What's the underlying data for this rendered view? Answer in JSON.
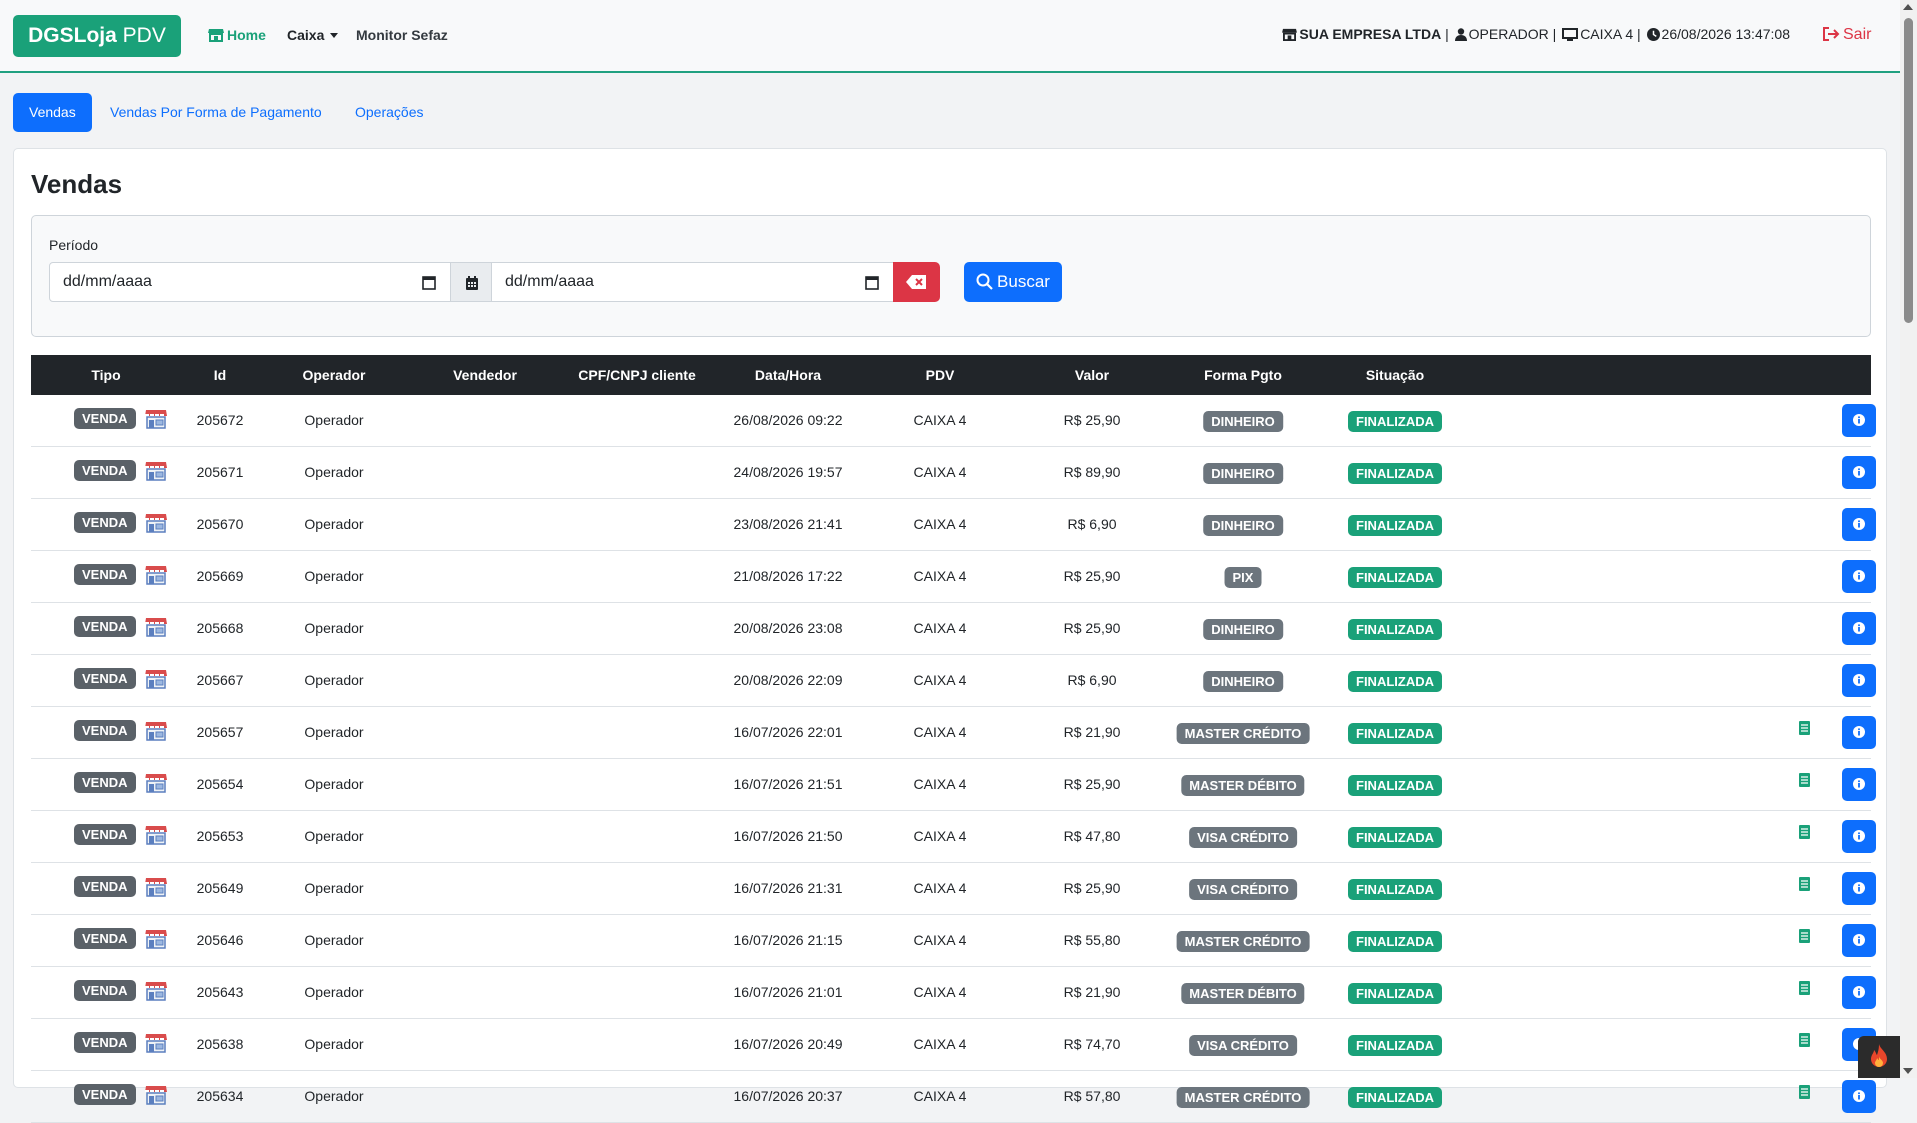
{
  "brand": {
    "name": "DGSLoja",
    "suffix": "PDV"
  },
  "nav": {
    "home": "Home",
    "caixa": "Caixa",
    "monitor": "Monitor Sefaz",
    "company": "SUA EMPRESA LTDA",
    "operator": "OPERADOR",
    "terminal": "CAIXA 4",
    "datetime": "26/08/2026 13:47:08",
    "separator": "|",
    "logout": "Sair"
  },
  "tabs": [
    {
      "label": "Vendas",
      "active": true
    },
    {
      "label": "Vendas Por Forma de Pagamento",
      "active": false
    },
    {
      "label": "Operações",
      "active": false
    }
  ],
  "page": {
    "title": "Vendas"
  },
  "filter": {
    "label": "Período",
    "date_from": "dd/mm/aaaa",
    "date_to": "dd/mm/aaaa",
    "search_label": "Buscar"
  },
  "table": {
    "headers": [
      "Tipo",
      "Id",
      "Operador",
      "Vendedor",
      "CPF/CNPJ cliente",
      "Data/Hora",
      "PDV",
      "Valor",
      "Forma Pgto",
      "Situação"
    ],
    "rows": [
      {
        "tipo": "VENDA",
        "id": "205672",
        "operador": "Operador",
        "vendedor": "",
        "cpf": "",
        "datahora": "26/08/2026 09:22",
        "pdv": "CAIXA 4",
        "valor": "R$ 25,90",
        "forma": "DINHEIRO",
        "situacao": "FINALIZADA",
        "nf": false
      },
      {
        "tipo": "VENDA",
        "id": "205671",
        "operador": "Operador",
        "vendedor": "",
        "cpf": "",
        "datahora": "24/08/2026 19:57",
        "pdv": "CAIXA 4",
        "valor": "R$ 89,90",
        "forma": "DINHEIRO",
        "situacao": "FINALIZADA",
        "nf": false
      },
      {
        "tipo": "VENDA",
        "id": "205670",
        "operador": "Operador",
        "vendedor": "",
        "cpf": "",
        "datahora": "23/08/2026 21:41",
        "pdv": "CAIXA 4",
        "valor": "R$ 6,90",
        "forma": "DINHEIRO",
        "situacao": "FINALIZADA",
        "nf": false
      },
      {
        "tipo": "VENDA",
        "id": "205669",
        "operador": "Operador",
        "vendedor": "",
        "cpf": "",
        "datahora": "21/08/2026 17:22",
        "pdv": "CAIXA 4",
        "valor": "R$ 25,90",
        "forma": "PIX",
        "situacao": "FINALIZADA",
        "nf": false
      },
      {
        "tipo": "VENDA",
        "id": "205668",
        "operador": "Operador",
        "vendedor": "",
        "cpf": "",
        "datahora": "20/08/2026 23:08",
        "pdv": "CAIXA 4",
        "valor": "R$ 25,90",
        "forma": "DINHEIRO",
        "situacao": "FINALIZADA",
        "nf": false
      },
      {
        "tipo": "VENDA",
        "id": "205667",
        "operador": "Operador",
        "vendedor": "",
        "cpf": "",
        "datahora": "20/08/2026 22:09",
        "pdv": "CAIXA 4",
        "valor": "R$ 6,90",
        "forma": "DINHEIRO",
        "situacao": "FINALIZADA",
        "nf": false
      },
      {
        "tipo": "VENDA",
        "id": "205657",
        "operador": "Operador",
        "vendedor": "",
        "cpf": "",
        "datahora": "16/07/2026 22:01",
        "pdv": "CAIXA 4",
        "valor": "R$ 21,90",
        "forma": "MASTER CRÉDITO",
        "situacao": "FINALIZADA",
        "nf": true
      },
      {
        "tipo": "VENDA",
        "id": "205654",
        "operador": "Operador",
        "vendedor": "",
        "cpf": "",
        "datahora": "16/07/2026 21:51",
        "pdv": "CAIXA 4",
        "valor": "R$ 25,90",
        "forma": "MASTER DÉBITO",
        "situacao": "FINALIZADA",
        "nf": true
      },
      {
        "tipo": "VENDA",
        "id": "205653",
        "operador": "Operador",
        "vendedor": "",
        "cpf": "",
        "datahora": "16/07/2026 21:50",
        "pdv": "CAIXA 4",
        "valor": "R$ 47,80",
        "forma": "VISA CRÉDITO",
        "situacao": "FINALIZADA",
        "nf": true
      },
      {
        "tipo": "VENDA",
        "id": "205649",
        "operador": "Operador",
        "vendedor": "",
        "cpf": "",
        "datahora": "16/07/2026 21:31",
        "pdv": "CAIXA 4",
        "valor": "R$ 25,90",
        "forma": "VISA CRÉDITO",
        "situacao": "FINALIZADA",
        "nf": true
      },
      {
        "tipo": "VENDA",
        "id": "205646",
        "operador": "Operador",
        "vendedor": "",
        "cpf": "",
        "datahora": "16/07/2026 21:15",
        "pdv": "CAIXA 4",
        "valor": "R$ 55,80",
        "forma": "MASTER CRÉDITO",
        "situacao": "FINALIZADA",
        "nf": true
      },
      {
        "tipo": "VENDA",
        "id": "205643",
        "operador": "Operador",
        "vendedor": "",
        "cpf": "",
        "datahora": "16/07/2026 21:01",
        "pdv": "CAIXA 4",
        "valor": "R$ 21,90",
        "forma": "MASTER DÉBITO",
        "situacao": "FINALIZADA",
        "nf": true
      },
      {
        "tipo": "VENDA",
        "id": "205638",
        "operador": "Operador",
        "vendedor": "",
        "cpf": "",
        "datahora": "16/07/2026 20:49",
        "pdv": "CAIXA 4",
        "valor": "R$ 74,70",
        "forma": "VISA CRÉDITO",
        "situacao": "FINALIZADA",
        "nf": true
      },
      {
        "tipo": "VENDA",
        "id": "205634",
        "operador": "Operador",
        "vendedor": "",
        "cpf": "",
        "datahora": "16/07/2026 20:37",
        "pdv": "CAIXA 4",
        "valor": "R$ 57,80",
        "forma": "MASTER CRÉDITO",
        "situacao": "FINALIZADA",
        "nf": true
      }
    ]
  },
  "colors": {
    "brand": "#1aa179",
    "primary": "#0d6efd",
    "danger": "#dc3545",
    "dark": "#212529",
    "badge_gray": "#6c757d"
  },
  "icons": {
    "home": "store-icon",
    "user": "user-icon",
    "terminal": "desktop-icon",
    "clock": "clock-icon",
    "logout": "sign-out-icon",
    "info": "info-circle-icon",
    "receipt": "receipt-icon"
  }
}
